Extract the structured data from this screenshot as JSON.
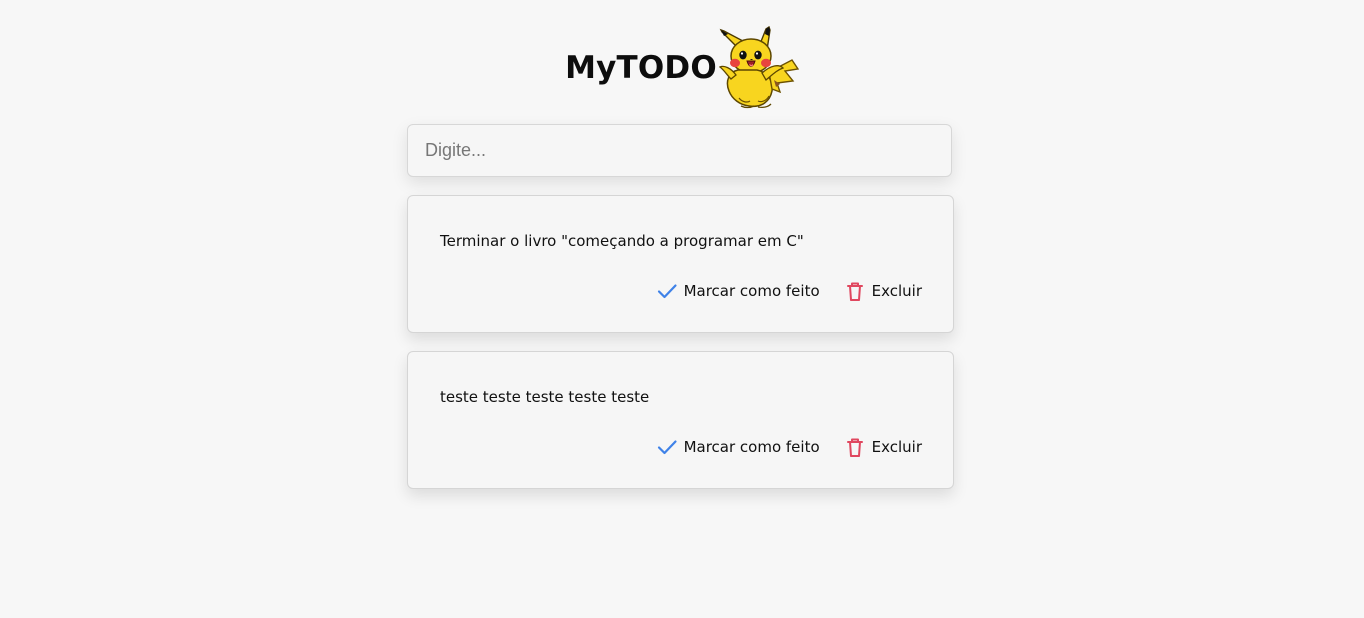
{
  "header": {
    "title": "MyTODO"
  },
  "input": {
    "placeholder": "Digite..."
  },
  "tasks": [
    {
      "text": "Terminar o livro \"começando a programar em C\"",
      "done_label": "Marcar como feito",
      "delete_label": "Excluir"
    },
    {
      "text": "teste teste teste teste teste",
      "done_label": "Marcar como feito",
      "delete_label": "Excluir"
    }
  ],
  "colors": {
    "background": "#f7f7f7",
    "check": "#3f82e8",
    "delete": "#e0475f",
    "mascot_yellow": "#f8d51f"
  },
  "icons": {
    "done": "checkmark-icon",
    "delete": "trash-icon",
    "mascot": "pikachu-logo"
  }
}
